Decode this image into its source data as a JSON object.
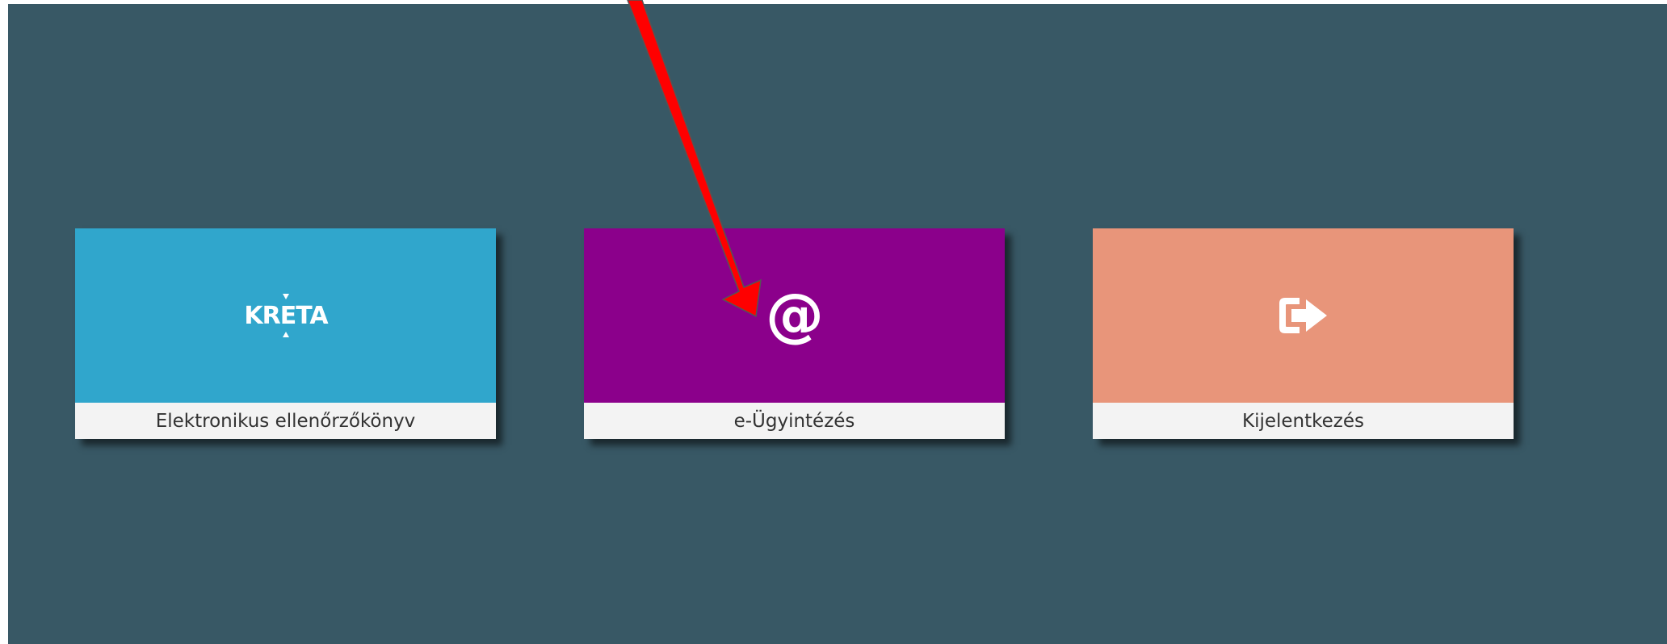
{
  "tiles": [
    {
      "id": "kreta",
      "label": "Elektronikus ellenőrzőkönyv",
      "icon": "kreta-logo",
      "logo_text": "KRÉTA",
      "color": "#30a6cc"
    },
    {
      "id": "e-ugyintezes",
      "label": "e-Ügyintézés",
      "icon": "at-icon",
      "color": "#8b008b"
    },
    {
      "id": "logout",
      "label": "Kijelentkezés",
      "icon": "logout-icon",
      "color": "#e8957a"
    }
  ],
  "background_color": "#385865",
  "annotation": {
    "type": "arrow",
    "color": "#ff0000",
    "points_to": "e-ugyintezes"
  }
}
